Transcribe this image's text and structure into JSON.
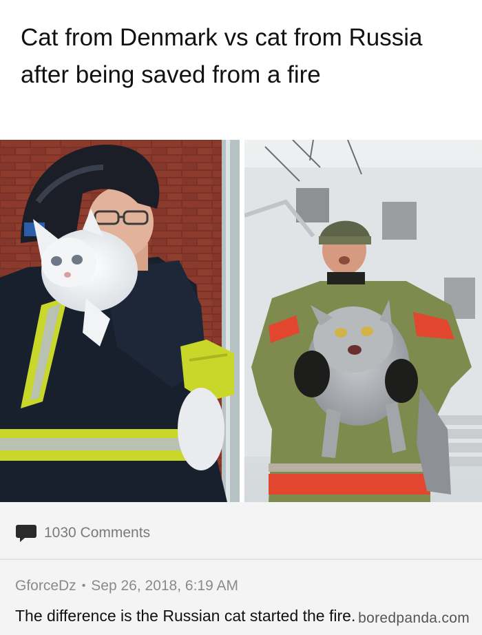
{
  "post": {
    "title": "Cat from Denmark vs cat from Russia after being saved from a fire"
  },
  "comments": {
    "count_label": "1030 Comments"
  },
  "comment": {
    "author": "GforceDz",
    "separator": "•",
    "timestamp": "Sep 26, 2018, 6:19 AM",
    "text": "The difference is the Russian cat started the fire."
  },
  "watermark": {
    "text": "boredpanda.com"
  },
  "colors": {
    "hi_vis_yellow": "#c8d72a",
    "reflective_stripe": "#b9c1b3",
    "russian_coat_red": "#e2462f",
    "russian_coat_khaki": "#7f8a4f"
  }
}
